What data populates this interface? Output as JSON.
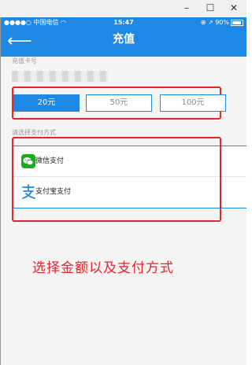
{
  "window": {
    "minimize_label": "–",
    "maximize_label": "☐",
    "close_label": "✕"
  },
  "status_bar": {
    "carrier": "●●●●○ 中国电信 ",
    "time": "15:47",
    "battery_text": "⊕ ↗ 90%"
  },
  "navbar": {
    "back_glyph": "⟵",
    "title": "充值"
  },
  "card_number": {
    "label": "充值卡号",
    "value": "•••• •••• •••• ••••"
  },
  "amounts": [
    {
      "label": "20元",
      "selected": true
    },
    {
      "label": "50元",
      "selected": false
    },
    {
      "label": "100元",
      "selected": false
    }
  ],
  "payment": {
    "section_label": "请选择支付方式",
    "options": [
      {
        "label": "微信支付",
        "icon": "wechat-icon"
      },
      {
        "label": "支付宝支付",
        "icon": "alipay-icon"
      }
    ]
  },
  "caption": "选择金额以及支付方式",
  "colors": {
    "brand_blue": "#1e88e5",
    "annotation_red": "#e8212b",
    "wechat_green": "#1aad19",
    "alipay_blue": "#1e88e5"
  }
}
